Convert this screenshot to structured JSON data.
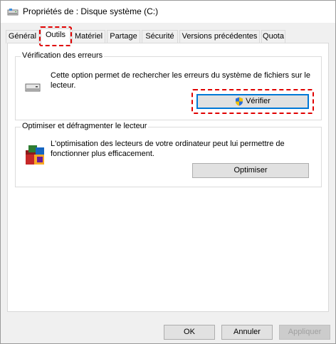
{
  "window": {
    "title": "Propriétés de : Disque système (C:)"
  },
  "tabs": [
    {
      "label": "Général"
    },
    {
      "label": "Outils"
    },
    {
      "label": "Matériel"
    },
    {
      "label": "Partage"
    },
    {
      "label": "Sécurité"
    },
    {
      "label": "Versions précédentes"
    },
    {
      "label": "Quota"
    }
  ],
  "active_tab": "Outils",
  "error_check": {
    "title": "Vérification des erreurs",
    "description": "Cette option permet de rechercher les erreurs du système de fichiers sur le lecteur.",
    "button_label": "Vérifier",
    "icon": "drive-icon"
  },
  "optimize": {
    "title": "Optimiser et défragmenter le lecteur",
    "description": "L'optimisation des lecteurs de votre ordinateur peut lui permettre de fonctionner plus efficacement.",
    "button_label": "Optimiser",
    "icon": "defrag-icon"
  },
  "footer": {
    "ok_label": "OK",
    "cancel_label": "Annuler",
    "apply_label": "Appliquer"
  },
  "colors": {
    "highlight": "#e00000",
    "focus": "#0078d7",
    "panel": "#ffffff",
    "window": "#f0f0f0"
  }
}
